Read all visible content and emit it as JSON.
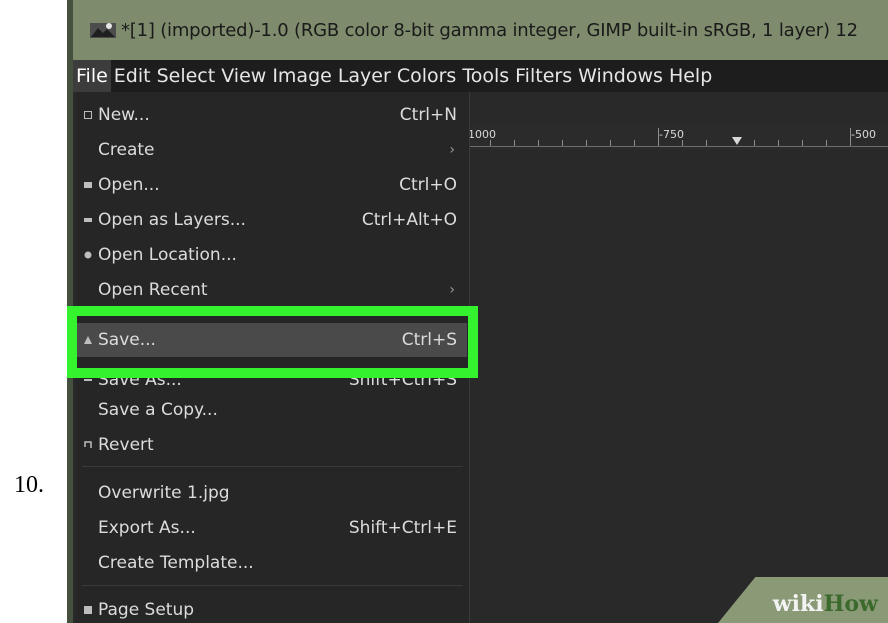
{
  "step_number": "10.",
  "title_bar": {
    "title": "*[1] (imported)-1.0 (RGB color 8-bit gamma integer, GIMP built-in sRGB, 1 layer) 12"
  },
  "menubar": {
    "items": [
      "File",
      "Edit",
      "Select",
      "View",
      "Image",
      "Layer",
      "Colors",
      "Tools",
      "Filters",
      "Windows",
      "Help"
    ],
    "active": "File"
  },
  "ruler": {
    "labels": [
      "1000",
      "-750",
      "-500"
    ]
  },
  "file_menu": {
    "items": [
      {
        "label": "New...",
        "shortcut": "Ctrl+N",
        "icon": "new-icon",
        "submenu": false
      },
      {
        "label": "Create",
        "shortcut": "",
        "icon": "",
        "submenu": true
      },
      {
        "label": "Open...",
        "shortcut": "Ctrl+O",
        "icon": "open-icon",
        "submenu": false
      },
      {
        "label": "Open as Layers...",
        "shortcut": "Ctrl+Alt+O",
        "icon": "open-layers-icon",
        "submenu": false
      },
      {
        "label": "Open Location...",
        "shortcut": "",
        "icon": "location-icon",
        "submenu": false
      },
      {
        "label": "Open Recent",
        "shortcut": "",
        "icon": "",
        "submenu": true
      },
      {
        "label": "Save...",
        "shortcut": "Ctrl+S",
        "icon": "save-icon",
        "submenu": false
      },
      {
        "label": "Save As...",
        "shortcut": "Shift+Ctrl+S",
        "icon": "save-as-icon",
        "submenu": false
      },
      {
        "label": "Save a Copy...",
        "shortcut": "",
        "icon": "",
        "submenu": false
      },
      {
        "label": "Revert",
        "shortcut": "",
        "icon": "revert-icon",
        "submenu": false
      },
      {
        "label": "Overwrite 1.jpg",
        "shortcut": "",
        "icon": "",
        "submenu": false
      },
      {
        "label": "Export As...",
        "shortcut": "Shift+Ctrl+E",
        "icon": "",
        "submenu": false
      },
      {
        "label": "Create Template...",
        "shortcut": "",
        "icon": "",
        "submenu": false
      },
      {
        "label": "Page Setup",
        "shortcut": "",
        "icon": "page-setup-icon",
        "submenu": false
      }
    ],
    "submenu_arrow": "›"
  },
  "watermark": {
    "wiki": "wiki",
    "how": "How"
  },
  "colors": {
    "highlight": "#35f22f",
    "titlebar": "#7e8b6c",
    "menu_bg": "#262626"
  }
}
